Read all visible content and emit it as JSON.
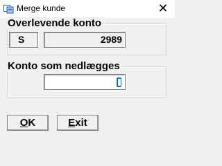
{
  "window": {
    "title": "Merge kunde",
    "close_label": "✕"
  },
  "surviving_account": {
    "label": "Overlevende konto",
    "type_code": "S",
    "account_number": "2989"
  },
  "account_to_close": {
    "label": "Konto som nedlægges",
    "value": ""
  },
  "buttons": {
    "ok": {
      "mnemonic": "O",
      "rest": "K"
    },
    "exit": {
      "mnemonic": "E",
      "rest": "xit"
    }
  }
}
